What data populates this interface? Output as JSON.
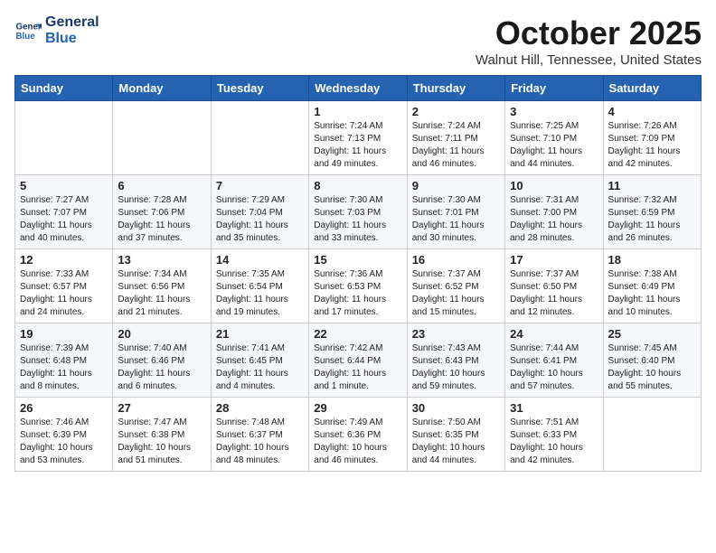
{
  "header": {
    "logo_line1": "General",
    "logo_line2": "Blue",
    "month": "October 2025",
    "location": "Walnut Hill, Tennessee, United States"
  },
  "weekdays": [
    "Sunday",
    "Monday",
    "Tuesday",
    "Wednesday",
    "Thursday",
    "Friday",
    "Saturday"
  ],
  "weeks": [
    [
      {
        "day": "",
        "info": ""
      },
      {
        "day": "",
        "info": ""
      },
      {
        "day": "",
        "info": ""
      },
      {
        "day": "1",
        "info": "Sunrise: 7:24 AM\nSunset: 7:13 PM\nDaylight: 11 hours\nand 49 minutes."
      },
      {
        "day": "2",
        "info": "Sunrise: 7:24 AM\nSunset: 7:11 PM\nDaylight: 11 hours\nand 46 minutes."
      },
      {
        "day": "3",
        "info": "Sunrise: 7:25 AM\nSunset: 7:10 PM\nDaylight: 11 hours\nand 44 minutes."
      },
      {
        "day": "4",
        "info": "Sunrise: 7:26 AM\nSunset: 7:09 PM\nDaylight: 11 hours\nand 42 minutes."
      }
    ],
    [
      {
        "day": "5",
        "info": "Sunrise: 7:27 AM\nSunset: 7:07 PM\nDaylight: 11 hours\nand 40 minutes."
      },
      {
        "day": "6",
        "info": "Sunrise: 7:28 AM\nSunset: 7:06 PM\nDaylight: 11 hours\nand 37 minutes."
      },
      {
        "day": "7",
        "info": "Sunrise: 7:29 AM\nSunset: 7:04 PM\nDaylight: 11 hours\nand 35 minutes."
      },
      {
        "day": "8",
        "info": "Sunrise: 7:30 AM\nSunset: 7:03 PM\nDaylight: 11 hours\nand 33 minutes."
      },
      {
        "day": "9",
        "info": "Sunrise: 7:30 AM\nSunset: 7:01 PM\nDaylight: 11 hours\nand 30 minutes."
      },
      {
        "day": "10",
        "info": "Sunrise: 7:31 AM\nSunset: 7:00 PM\nDaylight: 11 hours\nand 28 minutes."
      },
      {
        "day": "11",
        "info": "Sunrise: 7:32 AM\nSunset: 6:59 PM\nDaylight: 11 hours\nand 26 minutes."
      }
    ],
    [
      {
        "day": "12",
        "info": "Sunrise: 7:33 AM\nSunset: 6:57 PM\nDaylight: 11 hours\nand 24 minutes."
      },
      {
        "day": "13",
        "info": "Sunrise: 7:34 AM\nSunset: 6:56 PM\nDaylight: 11 hours\nand 21 minutes."
      },
      {
        "day": "14",
        "info": "Sunrise: 7:35 AM\nSunset: 6:54 PM\nDaylight: 11 hours\nand 19 minutes."
      },
      {
        "day": "15",
        "info": "Sunrise: 7:36 AM\nSunset: 6:53 PM\nDaylight: 11 hours\nand 17 minutes."
      },
      {
        "day": "16",
        "info": "Sunrise: 7:37 AM\nSunset: 6:52 PM\nDaylight: 11 hours\nand 15 minutes."
      },
      {
        "day": "17",
        "info": "Sunrise: 7:37 AM\nSunset: 6:50 PM\nDaylight: 11 hours\nand 12 minutes."
      },
      {
        "day": "18",
        "info": "Sunrise: 7:38 AM\nSunset: 6:49 PM\nDaylight: 11 hours\nand 10 minutes."
      }
    ],
    [
      {
        "day": "19",
        "info": "Sunrise: 7:39 AM\nSunset: 6:48 PM\nDaylight: 11 hours\nand 8 minutes."
      },
      {
        "day": "20",
        "info": "Sunrise: 7:40 AM\nSunset: 6:46 PM\nDaylight: 11 hours\nand 6 minutes."
      },
      {
        "day": "21",
        "info": "Sunrise: 7:41 AM\nSunset: 6:45 PM\nDaylight: 11 hours\nand 4 minutes."
      },
      {
        "day": "22",
        "info": "Sunrise: 7:42 AM\nSunset: 6:44 PM\nDaylight: 11 hours\nand 1 minute."
      },
      {
        "day": "23",
        "info": "Sunrise: 7:43 AM\nSunset: 6:43 PM\nDaylight: 10 hours\nand 59 minutes."
      },
      {
        "day": "24",
        "info": "Sunrise: 7:44 AM\nSunset: 6:41 PM\nDaylight: 10 hours\nand 57 minutes."
      },
      {
        "day": "25",
        "info": "Sunrise: 7:45 AM\nSunset: 6:40 PM\nDaylight: 10 hours\nand 55 minutes."
      }
    ],
    [
      {
        "day": "26",
        "info": "Sunrise: 7:46 AM\nSunset: 6:39 PM\nDaylight: 10 hours\nand 53 minutes."
      },
      {
        "day": "27",
        "info": "Sunrise: 7:47 AM\nSunset: 6:38 PM\nDaylight: 10 hours\nand 51 minutes."
      },
      {
        "day": "28",
        "info": "Sunrise: 7:48 AM\nSunset: 6:37 PM\nDaylight: 10 hours\nand 48 minutes."
      },
      {
        "day": "29",
        "info": "Sunrise: 7:49 AM\nSunset: 6:36 PM\nDaylight: 10 hours\nand 46 minutes."
      },
      {
        "day": "30",
        "info": "Sunrise: 7:50 AM\nSunset: 6:35 PM\nDaylight: 10 hours\nand 44 minutes."
      },
      {
        "day": "31",
        "info": "Sunrise: 7:51 AM\nSunset: 6:33 PM\nDaylight: 10 hours\nand 42 minutes."
      },
      {
        "day": "",
        "info": ""
      }
    ]
  ]
}
